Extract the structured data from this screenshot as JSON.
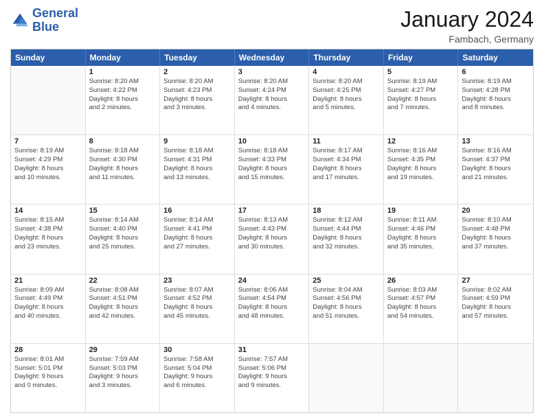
{
  "header": {
    "logo_line1": "General",
    "logo_line2": "Blue",
    "month": "January 2024",
    "location": "Fambach, Germany"
  },
  "days_of_week": [
    "Sunday",
    "Monday",
    "Tuesday",
    "Wednesday",
    "Thursday",
    "Friday",
    "Saturday"
  ],
  "weeks": [
    [
      {
        "day": "",
        "lines": []
      },
      {
        "day": "1",
        "lines": [
          "Sunrise: 8:20 AM",
          "Sunset: 4:22 PM",
          "Daylight: 8 hours",
          "and 2 minutes."
        ]
      },
      {
        "day": "2",
        "lines": [
          "Sunrise: 8:20 AM",
          "Sunset: 4:23 PM",
          "Daylight: 8 hours",
          "and 3 minutes."
        ]
      },
      {
        "day": "3",
        "lines": [
          "Sunrise: 8:20 AM",
          "Sunset: 4:24 PM",
          "Daylight: 8 hours",
          "and 4 minutes."
        ]
      },
      {
        "day": "4",
        "lines": [
          "Sunrise: 8:20 AM",
          "Sunset: 4:25 PM",
          "Daylight: 8 hours",
          "and 5 minutes."
        ]
      },
      {
        "day": "5",
        "lines": [
          "Sunrise: 8:19 AM",
          "Sunset: 4:27 PM",
          "Daylight: 8 hours",
          "and 7 minutes."
        ]
      },
      {
        "day": "6",
        "lines": [
          "Sunrise: 8:19 AM",
          "Sunset: 4:28 PM",
          "Daylight: 8 hours",
          "and 8 minutes."
        ]
      }
    ],
    [
      {
        "day": "7",
        "lines": [
          "Sunrise: 8:19 AM",
          "Sunset: 4:29 PM",
          "Daylight: 8 hours",
          "and 10 minutes."
        ]
      },
      {
        "day": "8",
        "lines": [
          "Sunrise: 8:18 AM",
          "Sunset: 4:30 PM",
          "Daylight: 8 hours",
          "and 11 minutes."
        ]
      },
      {
        "day": "9",
        "lines": [
          "Sunrise: 8:18 AM",
          "Sunset: 4:31 PM",
          "Daylight: 8 hours",
          "and 13 minutes."
        ]
      },
      {
        "day": "10",
        "lines": [
          "Sunrise: 8:18 AM",
          "Sunset: 4:33 PM",
          "Daylight: 8 hours",
          "and 15 minutes."
        ]
      },
      {
        "day": "11",
        "lines": [
          "Sunrise: 8:17 AM",
          "Sunset: 4:34 PM",
          "Daylight: 8 hours",
          "and 17 minutes."
        ]
      },
      {
        "day": "12",
        "lines": [
          "Sunrise: 8:16 AM",
          "Sunset: 4:35 PM",
          "Daylight: 8 hours",
          "and 19 minutes."
        ]
      },
      {
        "day": "13",
        "lines": [
          "Sunrise: 8:16 AM",
          "Sunset: 4:37 PM",
          "Daylight: 8 hours",
          "and 21 minutes."
        ]
      }
    ],
    [
      {
        "day": "14",
        "lines": [
          "Sunrise: 8:15 AM",
          "Sunset: 4:38 PM",
          "Daylight: 8 hours",
          "and 23 minutes."
        ]
      },
      {
        "day": "15",
        "lines": [
          "Sunrise: 8:14 AM",
          "Sunset: 4:40 PM",
          "Daylight: 8 hours",
          "and 25 minutes."
        ]
      },
      {
        "day": "16",
        "lines": [
          "Sunrise: 8:14 AM",
          "Sunset: 4:41 PM",
          "Daylight: 8 hours",
          "and 27 minutes."
        ]
      },
      {
        "day": "17",
        "lines": [
          "Sunrise: 8:13 AM",
          "Sunset: 4:43 PM",
          "Daylight: 8 hours",
          "and 30 minutes."
        ]
      },
      {
        "day": "18",
        "lines": [
          "Sunrise: 8:12 AM",
          "Sunset: 4:44 PM",
          "Daylight: 8 hours",
          "and 32 minutes."
        ]
      },
      {
        "day": "19",
        "lines": [
          "Sunrise: 8:11 AM",
          "Sunset: 4:46 PM",
          "Daylight: 8 hours",
          "and 35 minutes."
        ]
      },
      {
        "day": "20",
        "lines": [
          "Sunrise: 8:10 AM",
          "Sunset: 4:48 PM",
          "Daylight: 8 hours",
          "and 37 minutes."
        ]
      }
    ],
    [
      {
        "day": "21",
        "lines": [
          "Sunrise: 8:09 AM",
          "Sunset: 4:49 PM",
          "Daylight: 8 hours",
          "and 40 minutes."
        ]
      },
      {
        "day": "22",
        "lines": [
          "Sunrise: 8:08 AM",
          "Sunset: 4:51 PM",
          "Daylight: 8 hours",
          "and 42 minutes."
        ]
      },
      {
        "day": "23",
        "lines": [
          "Sunrise: 8:07 AM",
          "Sunset: 4:52 PM",
          "Daylight: 8 hours",
          "and 45 minutes."
        ]
      },
      {
        "day": "24",
        "lines": [
          "Sunrise: 8:06 AM",
          "Sunset: 4:54 PM",
          "Daylight: 8 hours",
          "and 48 minutes."
        ]
      },
      {
        "day": "25",
        "lines": [
          "Sunrise: 8:04 AM",
          "Sunset: 4:56 PM",
          "Daylight: 8 hours",
          "and 51 minutes."
        ]
      },
      {
        "day": "26",
        "lines": [
          "Sunrise: 8:03 AM",
          "Sunset: 4:57 PM",
          "Daylight: 8 hours",
          "and 54 minutes."
        ]
      },
      {
        "day": "27",
        "lines": [
          "Sunrise: 8:02 AM",
          "Sunset: 4:59 PM",
          "Daylight: 8 hours",
          "and 57 minutes."
        ]
      }
    ],
    [
      {
        "day": "28",
        "lines": [
          "Sunrise: 8:01 AM",
          "Sunset: 5:01 PM",
          "Daylight: 9 hours",
          "and 0 minutes."
        ]
      },
      {
        "day": "29",
        "lines": [
          "Sunrise: 7:59 AM",
          "Sunset: 5:03 PM",
          "Daylight: 9 hours",
          "and 3 minutes."
        ]
      },
      {
        "day": "30",
        "lines": [
          "Sunrise: 7:58 AM",
          "Sunset: 5:04 PM",
          "Daylight: 9 hours",
          "and 6 minutes."
        ]
      },
      {
        "day": "31",
        "lines": [
          "Sunrise: 7:57 AM",
          "Sunset: 5:06 PM",
          "Daylight: 9 hours",
          "and 9 minutes."
        ]
      },
      {
        "day": "",
        "lines": []
      },
      {
        "day": "",
        "lines": []
      },
      {
        "day": "",
        "lines": []
      }
    ]
  ]
}
